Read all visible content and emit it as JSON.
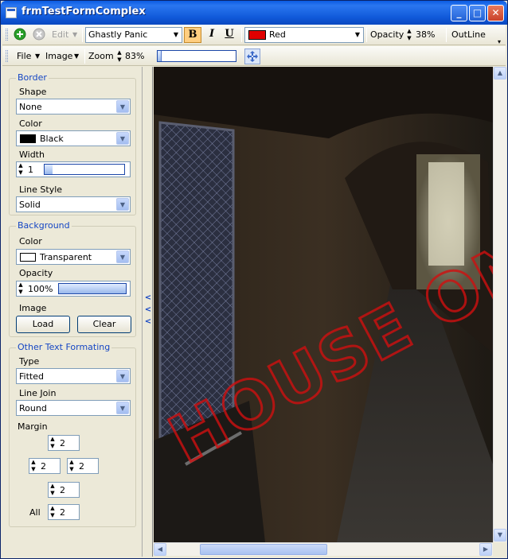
{
  "window": {
    "title": "frmTestFormComplex"
  },
  "toolbar1": {
    "edit_label": "Edit",
    "font_value": "Ghastly Panic",
    "bold_label": "B",
    "italic_label": "I",
    "underline_label": "U",
    "color_value": "Red",
    "color_hex": "#e00000",
    "opacity_label": "Opacity",
    "opacity_value": "38%",
    "outline_label": "OutLine"
  },
  "toolbar2": {
    "file_label": "File",
    "image_label": "Image",
    "zoom_label": "Zoom",
    "zoom_value": "83%",
    "zoom_fraction": 0.05
  },
  "border": {
    "title": "Border",
    "shape_label": "Shape",
    "shape_value": "None",
    "color_label": "Color",
    "color_value": "Black",
    "color_hex": "#000000",
    "width_label": "Width",
    "width_value": "1",
    "line_style_label": "Line Style",
    "line_style_value": "Solid"
  },
  "background": {
    "title": "Background",
    "color_label": "Color",
    "color_value": "Transparent",
    "opacity_label": "Opacity",
    "opacity_value": "100%",
    "image_label": "Image",
    "load_label": "Load",
    "clear_label": "Clear"
  },
  "other_text": {
    "title": "Other Text Formating",
    "type_label": "Type",
    "type_value": "Fitted",
    "line_join_label": "Line Join",
    "line_join_value": "Round",
    "margin_label": "Margin",
    "margin_top": "2",
    "margin_left": "2",
    "margin_right": "2",
    "margin_bottom": "2",
    "all_label": "All",
    "all_value": "2"
  },
  "canvas": {
    "overlay_text": "HOUSE ON HA"
  }
}
